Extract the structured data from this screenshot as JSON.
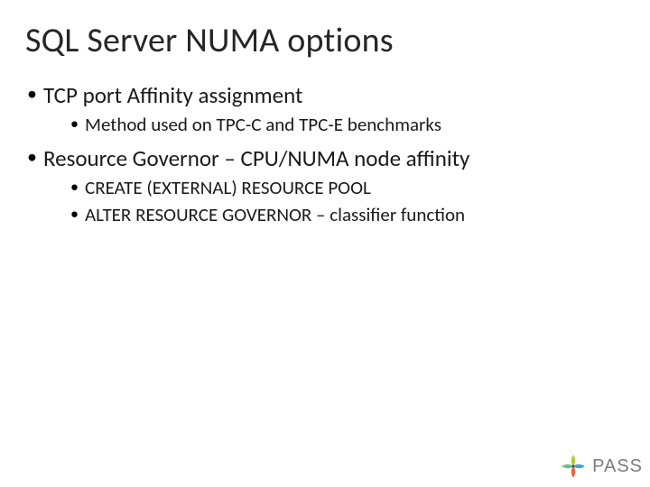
{
  "title": "SQL Server NUMA options",
  "bullets": [
    {
      "text": "TCP port Affinity assignment",
      "children": [
        {
          "text": "Method used on TPC-C and TPC-E benchmarks"
        }
      ]
    },
    {
      "text": "Resource Governor – CPU/NUMA node affinity",
      "children": [
        {
          "text": "CREATE (EXTERNAL) RESOURCE POOL"
        },
        {
          "text": "ALTER RESOURCE GOVERNOR – classifier function"
        }
      ]
    }
  ],
  "logo": {
    "text": "PASS",
    "colors": {
      "petal1": "#b7cb3a",
      "petal2": "#4aa0d9",
      "petal3": "#e0683f",
      "petal4": "#6abf88",
      "center": "#555555"
    }
  }
}
